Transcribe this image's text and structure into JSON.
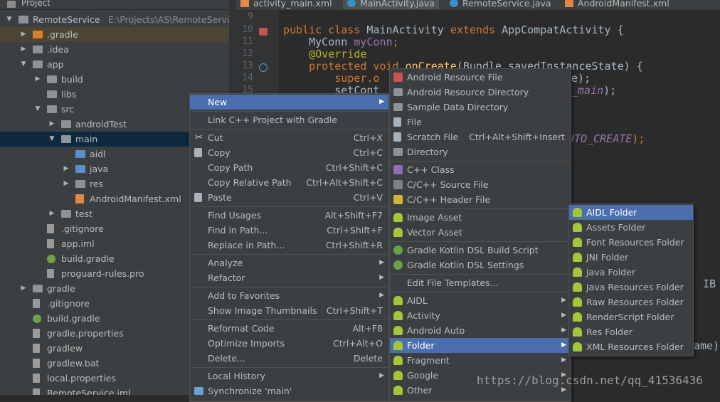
{
  "project_panel": {
    "title": "Project",
    "tree": [
      {
        "label": "RemoteService",
        "path": "E:\\Projects\\AS\\RemoteService",
        "depth": 0,
        "expanded": true,
        "icon": "folder-grey"
      },
      {
        "label": ".gradle",
        "depth": 1,
        "expanded": false,
        "icon": "folder-orange",
        "selected_context": true
      },
      {
        "label": ".idea",
        "depth": 1,
        "expanded": false,
        "icon": "folder-grey"
      },
      {
        "label": "app",
        "depth": 1,
        "expanded": true,
        "icon": "folder-grey"
      },
      {
        "label": "build",
        "depth": 2,
        "expanded": false,
        "icon": "folder-grey"
      },
      {
        "label": "libs",
        "depth": 2,
        "icon": "folder-grey"
      },
      {
        "label": "src",
        "depth": 2,
        "expanded": true,
        "icon": "folder-grey"
      },
      {
        "label": "androidTest",
        "depth": 3,
        "expanded": false,
        "icon": "folder-grey"
      },
      {
        "label": "main",
        "depth": 3,
        "expanded": true,
        "icon": "folder-grey",
        "selected": true
      },
      {
        "label": "aidl",
        "depth": 4,
        "icon": "folder-blue"
      },
      {
        "label": "java",
        "depth": 4,
        "expanded": false,
        "icon": "folder-blue"
      },
      {
        "label": "res",
        "depth": 4,
        "expanded": false,
        "icon": "folder-grey"
      },
      {
        "label": "AndroidManifest.xml",
        "depth": 4,
        "icon": "xml-file"
      },
      {
        "label": "test",
        "depth": 3,
        "expanded": false,
        "icon": "folder-grey"
      },
      {
        "label": ".gitignore",
        "depth": 2,
        "icon": "file"
      },
      {
        "label": "app.iml",
        "depth": 2,
        "icon": "file"
      },
      {
        "label": "build.gradle",
        "depth": 2,
        "icon": "gradle-file"
      },
      {
        "label": "proguard-rules.pro",
        "depth": 2,
        "icon": "file"
      },
      {
        "label": "gradle",
        "depth": 1,
        "expanded": false,
        "icon": "folder-grey"
      },
      {
        "label": ".gitignore",
        "depth": 1,
        "icon": "file"
      },
      {
        "label": "build.gradle",
        "depth": 1,
        "icon": "gradle-file"
      },
      {
        "label": "gradle.properties",
        "depth": 1,
        "icon": "file"
      },
      {
        "label": "gradlew",
        "depth": 1,
        "icon": "file"
      },
      {
        "label": "gradlew.bat",
        "depth": 1,
        "icon": "file"
      },
      {
        "label": "local.properties",
        "depth": 1,
        "icon": "file"
      },
      {
        "label": "RemoteService.iml",
        "depth": 1,
        "icon": "file"
      }
    ]
  },
  "editor": {
    "tabs": [
      {
        "label": "activity_main.xml",
        "icon": "xml-file-icon"
      },
      {
        "label": "MainActivity.java",
        "icon": "java-class-icon",
        "active": true
      },
      {
        "label": "RemoteService.java",
        "icon": "java-class-icon"
      },
      {
        "label": "AndroidManifest.xml",
        "icon": "xml-file-icon"
      }
    ],
    "line_numbers": [
      "9",
      "10",
      "11",
      "12",
      "13",
      "14",
      "15"
    ],
    "code": {
      "l10_kw": "public class ",
      "l10_name": "MainActivity ",
      "l10_ext": "extends ",
      "l10_super": "AppCompatActivity {",
      "l11_type": "MyConn ",
      "l11_field": "myConn",
      "l11_end": ";",
      "l12_ann": "@Override",
      "l13_kw": "protected void ",
      "l13_fn": "onCreate",
      "l13_args": "(Bundle savedInstanceState) {",
      "l14_a": "super.o",
      "l14_b": "e);",
      "l15_a": "setCont",
      "l15_b": "_main",
      "l15_c": ");",
      "l18_b": "UTO_CREATE",
      "l18_c": ");"
    },
    "peek_right_1": "IB",
    "peek_right_2": "ame)"
  },
  "context_menu": {
    "items": [
      {
        "label": "New",
        "submenu": true,
        "highlight": true
      },
      {
        "label": "Link C++ Project with Gradle"
      },
      {
        "label": "Cut",
        "shortcut": "Ctrl+X",
        "icon": "scissors-icon"
      },
      {
        "label": "Copy",
        "shortcut": "Ctrl+C",
        "icon": "copy-icon"
      },
      {
        "label": "Copy Path",
        "shortcut": "Ctrl+Shift+C"
      },
      {
        "label": "Copy Relative Path",
        "shortcut": "Ctrl+Alt+Shift+C"
      },
      {
        "label": "Paste",
        "shortcut": "Ctrl+V",
        "icon": "paste-icon"
      },
      {
        "label": "Find Usages",
        "shortcut": "Alt+Shift+F7"
      },
      {
        "label": "Find in Path...",
        "shortcut": "Ctrl+Shift+F"
      },
      {
        "label": "Replace in Path...",
        "shortcut": "Ctrl+Shift+R"
      },
      {
        "label": "Analyze",
        "submenu": true
      },
      {
        "label": "Refactor",
        "submenu": true
      },
      {
        "label": "Add to Favorites",
        "submenu": true
      },
      {
        "label": "Show Image Thumbnails",
        "shortcut": "Ctrl+Shift+T"
      },
      {
        "label": "Reformat Code",
        "shortcut": "Alt+F8"
      },
      {
        "label": "Optimize Imports",
        "shortcut": "Ctrl+Alt+O"
      },
      {
        "label": "Delete...",
        "shortcut": "Delete"
      },
      {
        "label": "Local History",
        "submenu": true
      },
      {
        "label": "Synchronize 'main'",
        "icon": "sync-icon"
      }
    ]
  },
  "new_submenu": {
    "items": [
      {
        "label": "Android Resource File",
        "icon": "android-resource-file-icon"
      },
      {
        "label": "Android Resource Directory",
        "icon": "folder-icon"
      },
      {
        "label": "Sample Data Directory",
        "icon": "folder-icon"
      },
      {
        "label": "File",
        "icon": "file-icon"
      },
      {
        "label": "Scratch File",
        "shortcut": "Ctrl+Alt+Shift+Insert",
        "icon": "scratch-file-icon"
      },
      {
        "label": "Directory",
        "icon": "folder-icon"
      },
      {
        "label": "C++ Class",
        "icon": "cpp-class-icon"
      },
      {
        "label": "C/C++ Source File",
        "icon": "cpp-source-icon"
      },
      {
        "label": "C/C++ Header File",
        "icon": "cpp-header-icon"
      },
      {
        "label": "Image Asset",
        "icon": "android-icon"
      },
      {
        "label": "Vector Asset",
        "icon": "android-icon"
      },
      {
        "label": "Gradle Kotlin DSL Build Script",
        "icon": "gradle-icon"
      },
      {
        "label": "Gradle Kotlin DSL Settings",
        "icon": "gradle-icon"
      },
      {
        "label": "Edit File Templates..."
      },
      {
        "label": "AIDL",
        "submenu": true,
        "icon": "android-icon"
      },
      {
        "label": "Activity",
        "submenu": true,
        "icon": "android-icon"
      },
      {
        "label": "Android Auto",
        "submenu": true,
        "icon": "android-icon"
      },
      {
        "label": "Folder",
        "submenu": true,
        "highlight": true,
        "icon": "android-icon"
      },
      {
        "label": "Fragment",
        "submenu": true,
        "icon": "android-icon"
      },
      {
        "label": "Google",
        "submenu": true,
        "icon": "android-icon"
      },
      {
        "label": "Other",
        "submenu": true,
        "icon": "android-icon"
      }
    ]
  },
  "folder_submenu": {
    "items": [
      {
        "label": "AIDL Folder",
        "highlight": true
      },
      {
        "label": "Assets Folder"
      },
      {
        "label": "Font Resources Folder"
      },
      {
        "label": "JNI Folder"
      },
      {
        "label": "Java Folder"
      },
      {
        "label": "Java Resources Folder"
      },
      {
        "label": "Raw Resources Folder"
      },
      {
        "label": "RenderScript Folder"
      },
      {
        "label": "Res Folder"
      },
      {
        "label": "XML Resources Folder"
      }
    ]
  },
  "watermark": "https://blog.csdn.net/qq_41536436",
  "colors": {
    "menu_bg": "#3c3f41",
    "highlight": "#4b6eaf",
    "editor_bg": "#2b2b2b",
    "keyword": "#cc7832",
    "annotation": "#bbb529",
    "method": "#ffc66d",
    "field": "#9876aa"
  }
}
